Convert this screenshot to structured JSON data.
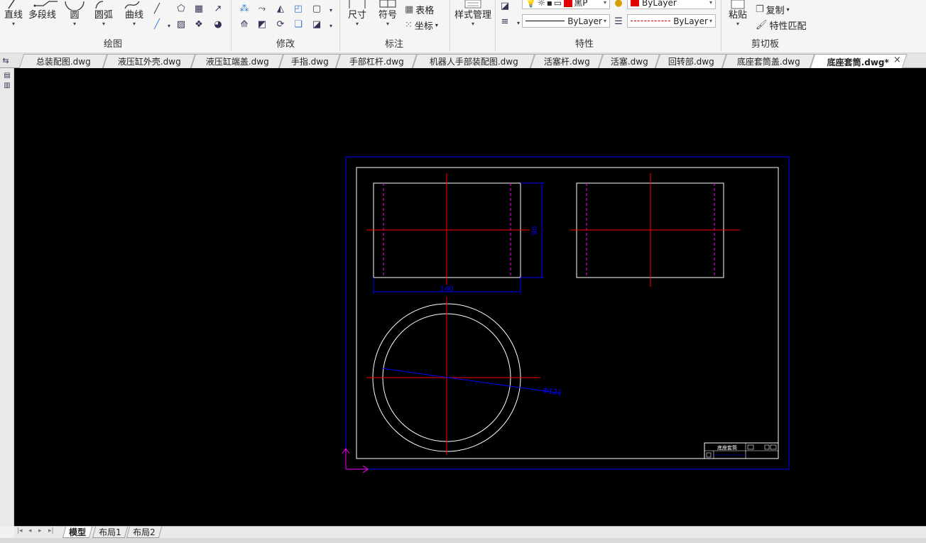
{
  "ribbon": {
    "draw_group": {
      "label": "绘图",
      "line": "直线",
      "polyline": "多段线",
      "circle": "圆",
      "arc": "圆弧",
      "curve": "曲线"
    },
    "modify_group": {
      "label": "修改"
    },
    "annotate_group": {
      "label": "标注",
      "dimension": "尺寸",
      "symbol": "符号",
      "table": "表格",
      "coordinate": "坐标"
    },
    "style_manage": "样式管理",
    "properties_group": {
      "label": "特性",
      "color_combo": "黑P",
      "layer_color_combo": "ByLayer",
      "linetype_combo": "ByLayer",
      "lineweight_combo": "ByLayer"
    },
    "clipboard_group": {
      "label": "剪切板",
      "paste": "粘贴",
      "copy": "复制",
      "match_props": "特性匹配"
    }
  },
  "tabs": [
    {
      "label": "总装配图.dwg"
    },
    {
      "label": "液压缸外壳.dwg"
    },
    {
      "label": "液压缸端盖.dwg"
    },
    {
      "label": "手指.dwg"
    },
    {
      "label": "手部杠杆.dwg"
    },
    {
      "label": "机器人手部装配图.dwg"
    },
    {
      "label": "活塞杆.dwg"
    },
    {
      "label": "活塞.dwg"
    },
    {
      "label": "回转部.dwg"
    },
    {
      "label": "底座套筒盖.dwg"
    },
    {
      "label": "底座套筒.dwg*",
      "active": true
    }
  ],
  "drawing": {
    "dim_width": "140",
    "dim_height": "90",
    "dim_diameter": "Φ121",
    "title_block_text": "底座套筒"
  },
  "layout_tabs": [
    {
      "label": "模型",
      "active": true
    },
    {
      "label": "布局1"
    },
    {
      "label": "布局2"
    }
  ],
  "colors": {
    "canvas_bg": "#000000",
    "center_line": "#ff0000",
    "hidden_line": "#ff00ff",
    "dimension": "#0000ff",
    "border": "#ffffff",
    "frame": "#0000ff"
  }
}
